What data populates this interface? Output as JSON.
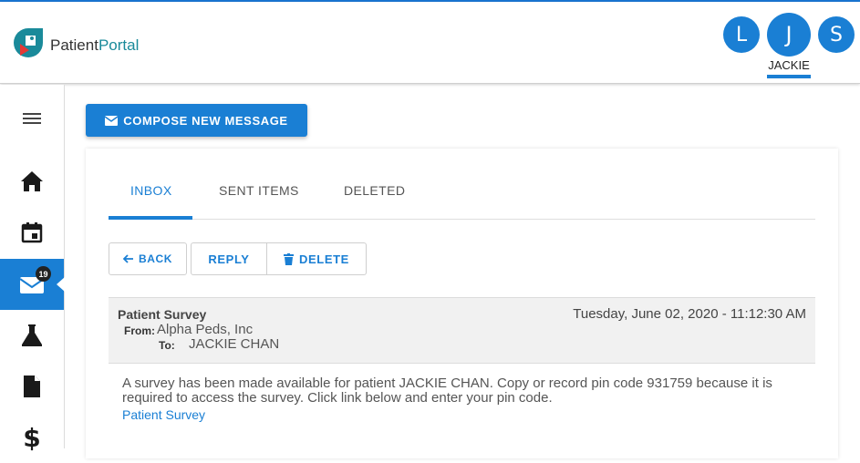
{
  "app": {
    "logo_part1": "Patient",
    "logo_part2": "Portal"
  },
  "avatars": [
    {
      "letter": "L"
    },
    {
      "letter": "J",
      "name": "JACKIE"
    },
    {
      "letter": "S"
    }
  ],
  "sidebar": {
    "items": [
      "menu-icon",
      "home-icon",
      "calendar-icon",
      "mail-icon",
      "lab-flask-icon",
      "document-icon",
      "dollar-icon"
    ],
    "mail_badge": "19"
  },
  "compose": {
    "label": "COMPOSE NEW MESSAGE"
  },
  "tabs": [
    {
      "label": "INBOX",
      "active": true
    },
    {
      "label": "SENT ITEMS"
    },
    {
      "label": "DELETED"
    }
  ],
  "actions": {
    "back": "BACK",
    "reply": "REPLY",
    "delete": "DELETE"
  },
  "message": {
    "subject": "Patient Survey",
    "date": "Tuesday, June 02, 2020 - 11:12:30 AM",
    "from_label": "From:",
    "from": "Alpha Peds, Inc",
    "to_label": "To:",
    "to": "JACKIE CHAN",
    "body": "A survey has been made available for patient JACKIE CHAN. Copy or record pin code 931759 because it is required to access the survey. Click link below and enter your pin code.",
    "link": "Patient Survey"
  },
  "colors": {
    "accent": "#1a7fd4",
    "logo_teal": "#1a8a9a"
  }
}
